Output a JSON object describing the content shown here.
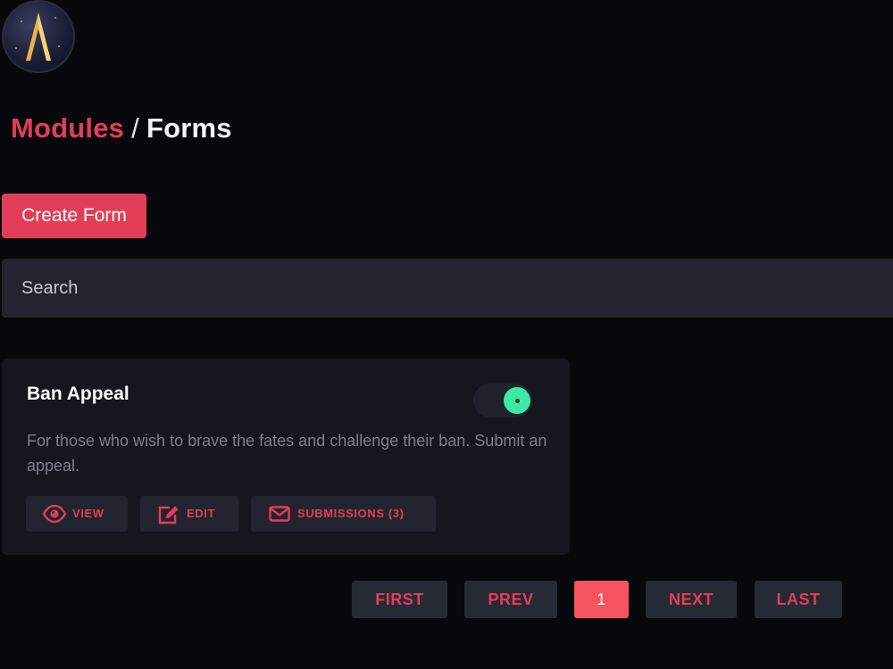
{
  "breadcrumb": {
    "parent": "Modules",
    "separator": "/",
    "current": "Forms"
  },
  "toolbar": {
    "create_label": "Create Form"
  },
  "search": {
    "placeholder": "Search"
  },
  "forms": [
    {
      "title": "Ban Appeal",
      "description": "For those who wish to brave the fates and challenge their ban. Submit an appeal.",
      "enabled": true,
      "actions": {
        "view_label": "VIEW",
        "edit_label": "EDIT",
        "submissions_label": "SUBMISSIONS (3)"
      },
      "icons": {
        "view": "eye-icon",
        "edit": "edit-icon",
        "submissions": "envelope-icon"
      }
    }
  ],
  "pagination": {
    "first_label": "FIRST",
    "prev_label": "PREV",
    "current_page": "1",
    "next_label": "NEXT",
    "last_label": "LAST"
  },
  "colors": {
    "accent": "#e23e57",
    "toggle_on": "#3ee8a5",
    "background": "#07080c",
    "card": "#15171f"
  },
  "logo": {
    "icon": "logo-icon"
  }
}
